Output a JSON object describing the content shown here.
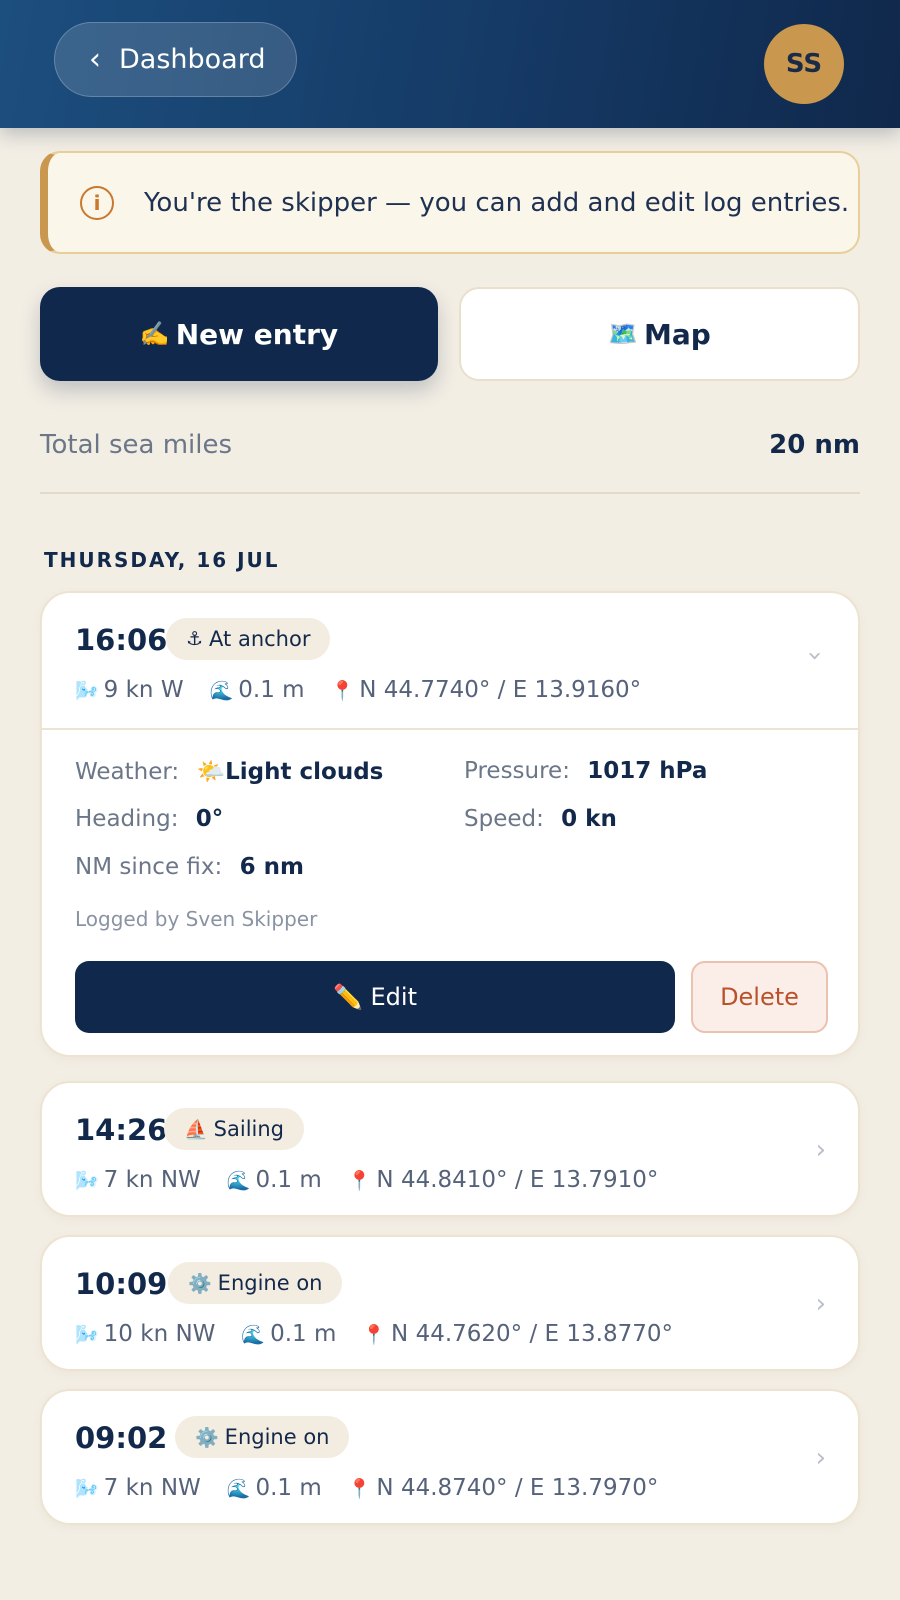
{
  "header": {
    "back_label": "Dashboard",
    "avatar_initials": "SS"
  },
  "notice": {
    "text": "You're the skipper — you can add and edit log entries."
  },
  "actions": {
    "new_entry_label": "New entry",
    "new_entry_emoji": "✍️",
    "map_label": "Map",
    "map_emoji": "🗺️"
  },
  "stats": {
    "label": "Total sea miles",
    "value": "20 nm"
  },
  "day_label": "THURSDAY, 16 JUL",
  "icons": {
    "wind": "🌬️",
    "wave": "🌊",
    "pin": "📍"
  },
  "entries": [
    {
      "time": "16:06",
      "status_icon": "⚓",
      "status": "At anchor",
      "wind": "9 kn W",
      "wave": "0.1 m",
      "position": "N 44.7740° / E 13.9160°",
      "expanded": true,
      "details": {
        "weather_label": "Weather:",
        "weather_icon": "🌤️",
        "weather_value": "Light clouds",
        "pressure_label": "Pressure:",
        "pressure_value": "1017 hPa",
        "heading_label": "Heading:",
        "heading_value": "0°",
        "speed_label": "Speed:",
        "speed_value": "0 kn",
        "nm_label": "NM since fix:",
        "nm_value": "6 nm",
        "logged_by": "Logged by Sven Skipper",
        "edit_label": "✏️ Edit",
        "delete_label": "Delete"
      }
    },
    {
      "time": "14:26",
      "status_icon": "⛵",
      "status": "Sailing",
      "wind": "7 kn NW",
      "wave": "0.1 m",
      "position": "N 44.8410° / E 13.7910°"
    },
    {
      "time": "10:09",
      "status_icon": "⚙️",
      "status": "Engine on",
      "wind": "10 kn NW",
      "wave": "0.1 m",
      "position": "N 44.7620° / E 13.8770°"
    },
    {
      "time": "09:02",
      "status_icon": "⚙️",
      "status": "Engine on",
      "wind": "7 kn NW",
      "wave": "0.1 m",
      "position": "N 44.8740° / E 13.7970°"
    }
  ]
}
